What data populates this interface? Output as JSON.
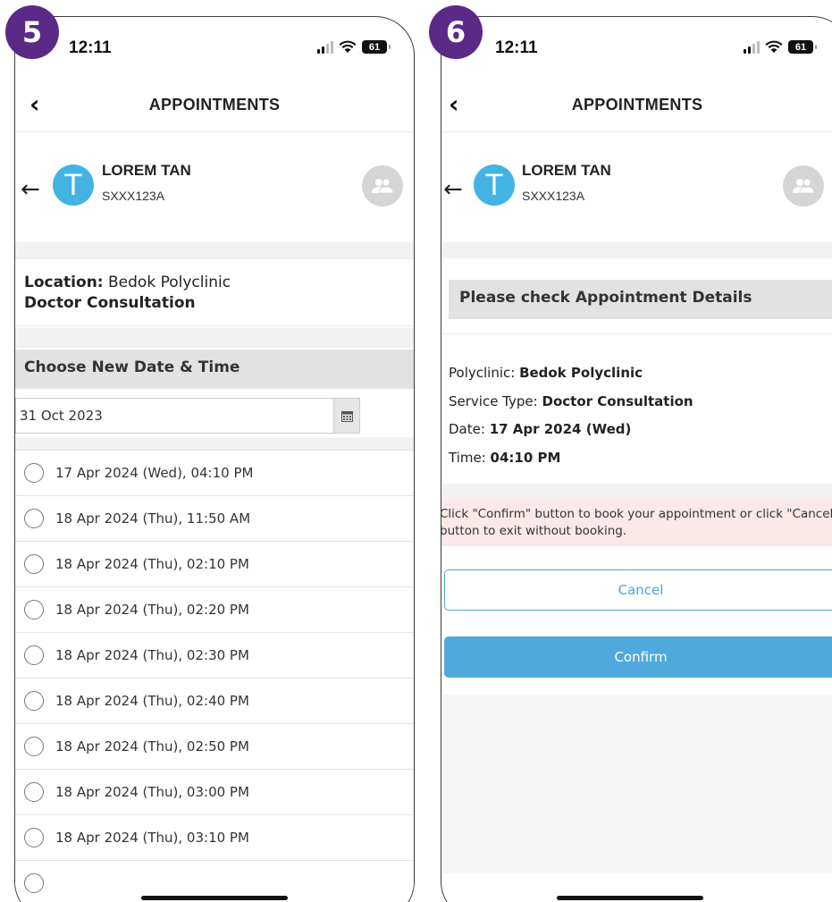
{
  "screen5": {
    "step": "5",
    "status": {
      "time": "12:11",
      "battery": "61"
    },
    "nav": {
      "back": "‹",
      "title": "APPOINTMENTS"
    },
    "profile": {
      "initial": "T",
      "name": "LOREM TAN",
      "id": "SXXX123A"
    },
    "location_label": "Location:",
    "location_value": "Bedok Polyclinic",
    "service": "Doctor Consultation",
    "section_title": "Choose New Date & Time",
    "date_value": "31 Oct 2023",
    "slots": [
      "17 Apr 2024 (Wed), 04:10 PM",
      "18 Apr 2024 (Thu), 11:50 AM",
      "18 Apr 2024 (Thu), 02:10 PM",
      "18 Apr 2024 (Thu), 02:20 PM",
      "18 Apr 2024 (Thu), 02:30 PM",
      "18 Apr 2024 (Thu), 02:40 PM",
      "18 Apr 2024 (Thu), 02:50 PM",
      "18 Apr 2024 (Thu), 03:00 PM",
      "18 Apr 2024 (Thu), 03:10 PM"
    ]
  },
  "screen6": {
    "step": "6",
    "status": {
      "time": "12:11",
      "battery": "61"
    },
    "nav": {
      "back": "‹",
      "title": "APPOINTMENTS"
    },
    "profile": {
      "initial": "T",
      "name": "LOREM TAN",
      "id": "SXXX123A"
    },
    "check_title": "Please check Appointment Details",
    "details": {
      "polyclinic_label": "Polyclinic:",
      "polyclinic_value": "Bedok Polyclinic",
      "service_label": "Service Type:",
      "service_value": "Doctor Consultation",
      "date_label": "Date:",
      "date_value": "17 Apr 2024 (Wed)",
      "time_label": "Time:",
      "time_value": "04:10 PM"
    },
    "alert_text": "Click \"Confirm\" button to book your appointment or click \"Cancel\" button to exit without booking.",
    "cancel_label": "Cancel",
    "confirm_label": "Confirm"
  },
  "colors": {
    "badge": "#5b2a86",
    "avatar": "#43b3e3",
    "primary": "#4fa9dc",
    "alert_bg": "#fbe8e8"
  }
}
